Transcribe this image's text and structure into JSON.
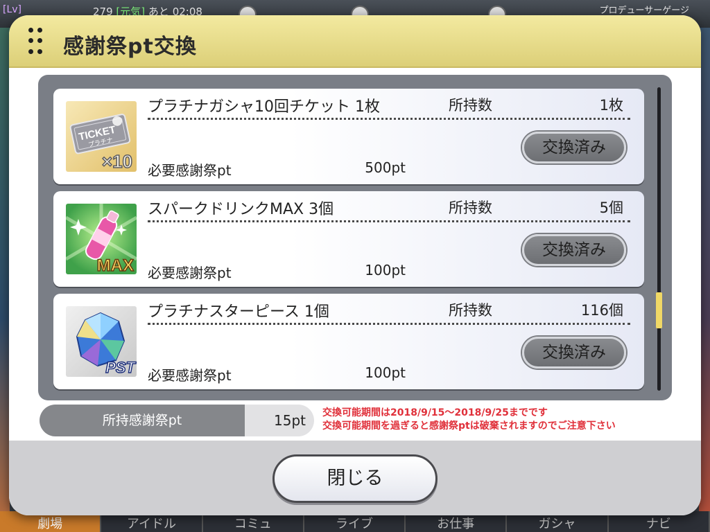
{
  "background": {
    "level_label": "[Lv]",
    "stamina_text": "279",
    "stamina_status": "[元気]",
    "time_text": "あと 02:08",
    "gauge_label": "プロデューサーゲージ",
    "nav_tabs": [
      "劇場",
      "アイドル",
      "コミュ",
      "ライブ",
      "お仕事",
      "ガシャ",
      "ナビ"
    ]
  },
  "modal": {
    "title": "感謝祭pt交換",
    "items": [
      {
        "name": "プラチナガシャ10回チケット 1枚",
        "holding_label": "所持数",
        "holding_value": "1枚",
        "required_label": "必要感謝祭pt",
        "required_value": "500pt",
        "button_label": "交換済み",
        "icon": "ticket-icon",
        "icon_text": "TICKET",
        "icon_sub": "プラチナ",
        "icon_badge": "×10"
      },
      {
        "name": "スパークドリンクMAX 3個",
        "holding_label": "所持数",
        "holding_value": "5個",
        "required_label": "必要感謝祭pt",
        "required_value": "100pt",
        "button_label": "交換済み",
        "icon": "drink-icon",
        "icon_badge": "MAX"
      },
      {
        "name": "プラチナスターピース 1個",
        "holding_label": "所持数",
        "holding_value": "116個",
        "required_label": "必要感謝祭pt",
        "required_value": "100pt",
        "button_label": "交換済み",
        "icon": "gem-icon",
        "icon_badge": "PST"
      }
    ],
    "points_label": "所持感謝祭pt",
    "points_value": "15pt",
    "notice_line1": "交換可能期間は2018/9/15～2018/9/25までです",
    "notice_line2": "交換可能期間を過ぎると感謝祭ptは破棄されますのでご注意下さい",
    "close_label": "閉じる"
  },
  "colors": {
    "header": "#e8dc8c",
    "notice": "#e0303a",
    "scroll_thumb": "#f0d866"
  }
}
